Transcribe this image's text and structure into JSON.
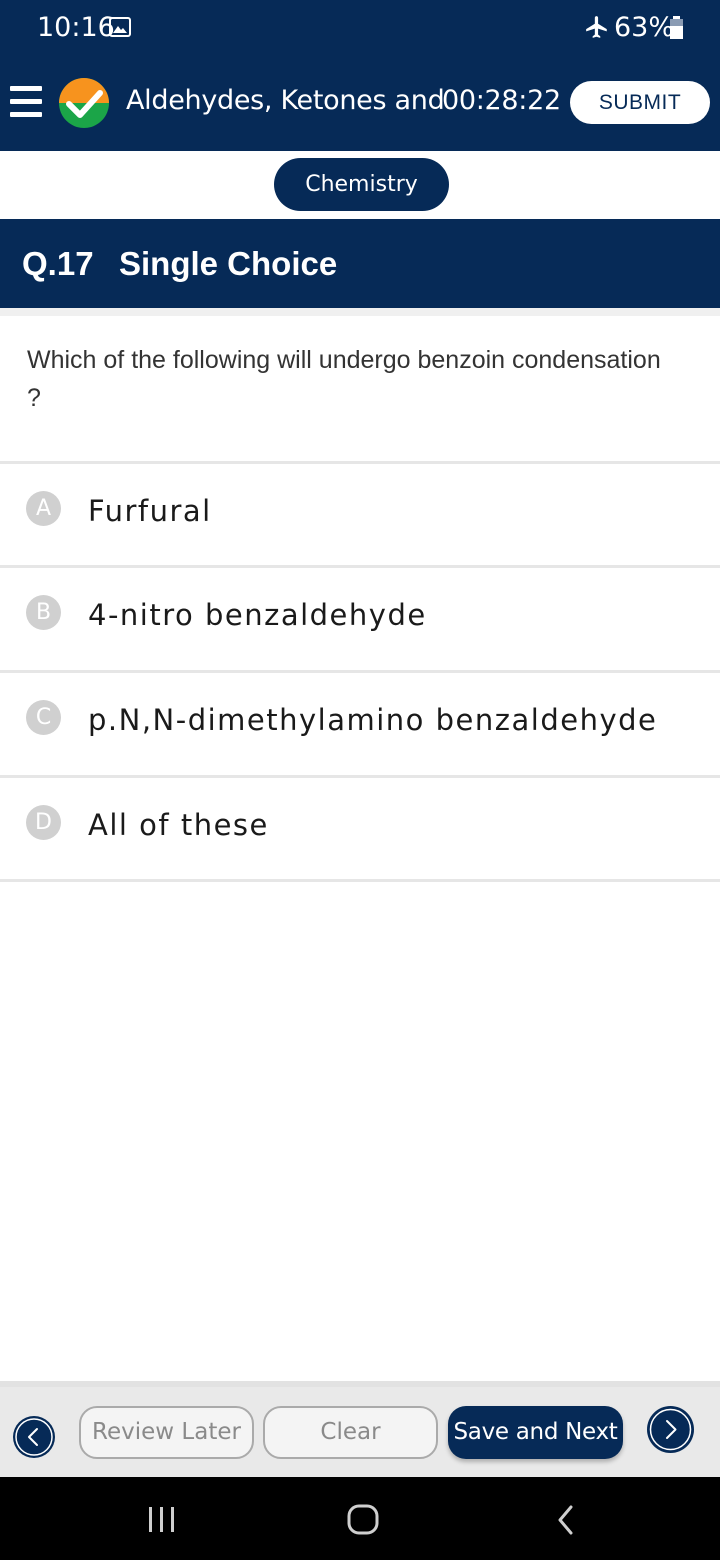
{
  "status_bar": {
    "time": "10:16",
    "battery_percent": "63%",
    "icons": [
      "gallery-icon",
      "airplane-icon",
      "battery-icon"
    ]
  },
  "header": {
    "title": "Aldehydes, Ketones and",
    "timer": "00:28:22",
    "submit_label": "SUBMIT",
    "colors": {
      "primary": "#062a57",
      "logo_orange": "#f7931e",
      "logo_green": "#1ba548"
    }
  },
  "subject": {
    "label": "Chemistry"
  },
  "question": {
    "number": "Q.17",
    "type": "Single Choice",
    "text": "Which of the following will undergo benzoin condensation ?",
    "options": [
      {
        "letter": "A",
        "text": "Furfural"
      },
      {
        "letter": "B",
        "text": "4-nitro benzaldehyde"
      },
      {
        "letter": "C",
        "text": "p.N,N-dimethylamino benzaldehyde"
      },
      {
        "letter": "D",
        "text": "All of these"
      }
    ]
  },
  "footer": {
    "review_label": "Review Later",
    "clear_label": "Clear",
    "save_label": "Save and Next"
  }
}
